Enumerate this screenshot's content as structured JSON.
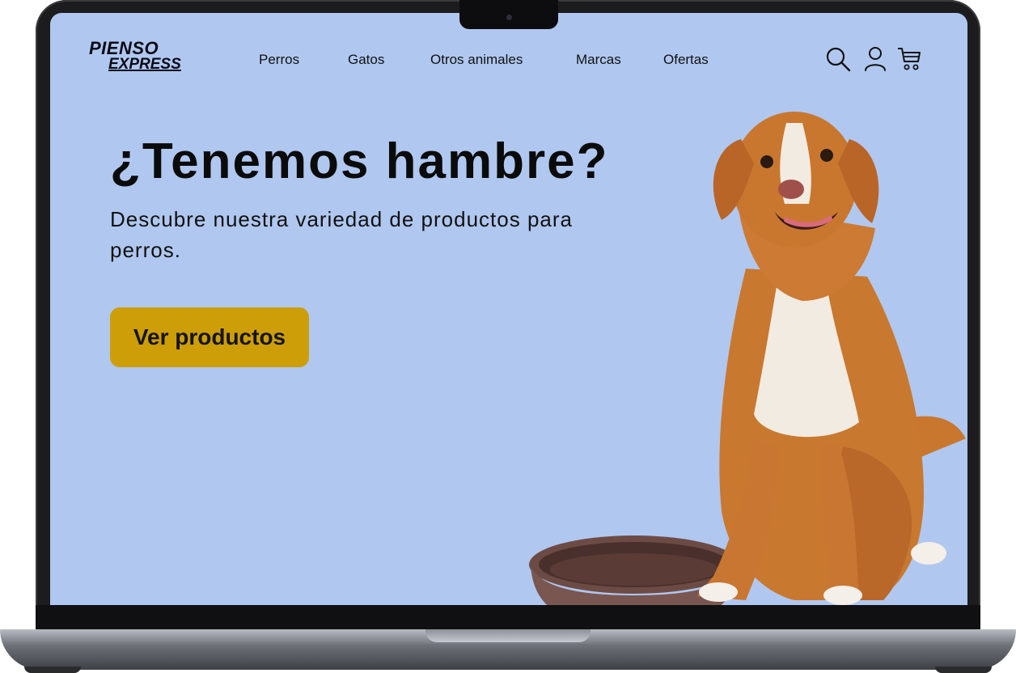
{
  "brand": {
    "line1": "PIENSO",
    "line2": "EXPRESS"
  },
  "nav": {
    "items": [
      "Perros",
      "Gatos",
      "Otros animales",
      "Marcas",
      "Ofertas"
    ]
  },
  "header_icons": [
    "search-icon",
    "user-icon",
    "cart-icon"
  ],
  "hero": {
    "title": "¿Tenemos hambre?",
    "subtitle": "Descubre nuestra variedad de productos para perros.",
    "cta_label": "Ver productos"
  },
  "colors": {
    "background": "#b0c8f0",
    "cta": "#cd9e08",
    "text": "#0b0b0b"
  }
}
